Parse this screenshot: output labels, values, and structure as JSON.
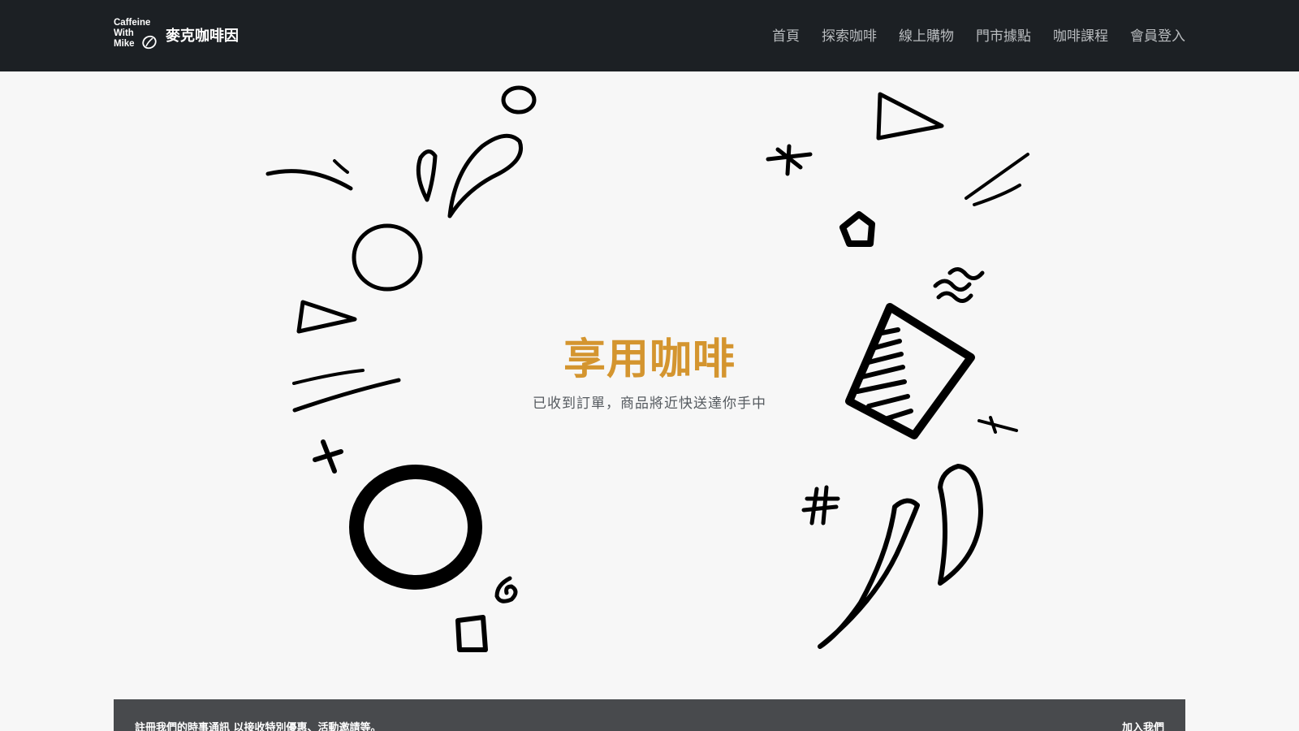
{
  "brand": {
    "logo_lines": [
      "Caffeine",
      "With",
      "Mike"
    ],
    "name": "麥克咖啡因"
  },
  "nav": {
    "items": [
      {
        "label": "首頁"
      },
      {
        "label": "探索咖啡"
      },
      {
        "label": "線上購物"
      },
      {
        "label": "門市據點"
      },
      {
        "label": "咖啡課程"
      },
      {
        "label": "會員登入"
      }
    ]
  },
  "hero": {
    "title": "享用咖啡",
    "subtitle": "已收到訂單，商品將近快送達你手中"
  },
  "newsletter": {
    "message": "註冊我們的時事通訊 以接收特別優惠、活動邀請等。",
    "join_label": "加入我們"
  },
  "colors": {
    "navbar_bg": "#1c2024",
    "accent": "#d4952f",
    "page_bg": "#f7f7f7",
    "newsletter_bg": "#484a4d"
  }
}
